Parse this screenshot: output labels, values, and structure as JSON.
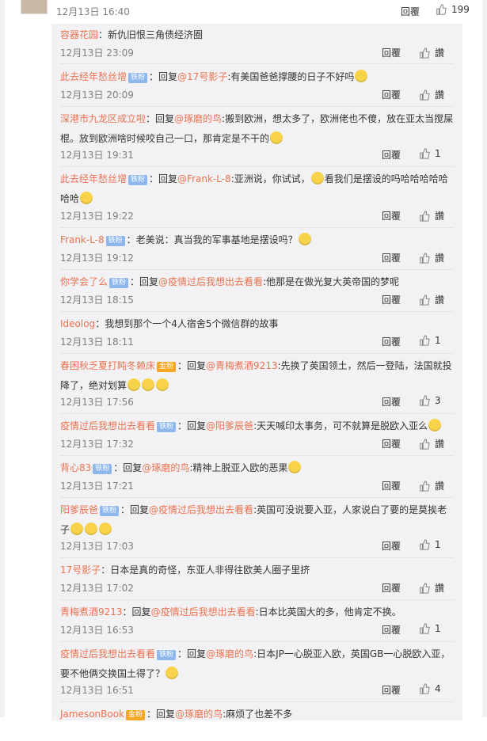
{
  "top": {
    "time": "12月13日 16:40",
    "reply": "回覆",
    "likes": "199"
  },
  "reply_label": "回覆",
  "replies": [
    {
      "user": "容器花园",
      "text": "：新仇旧恨三角债经济圈",
      "time": "12月13日 23:09",
      "likes": "讚"
    },
    {
      "user": "此去经年愁丝增",
      "badge": "铁粉",
      "text": "：回复",
      "mention": "@17号影子",
      "text2": ":有美国爸爸撑腰的日子不好吗",
      "time": "12月13日 20:09",
      "likes": "讚"
    },
    {
      "user": "深港市九龙区成立啦",
      "text": "：回复",
      "mention": "@琢磨的鸟",
      "text2": ":搬到欧洲，想太多了，欧洲佬也不傻，放在亚太当搅屎棍。放到欧洲啥时候咬自己一口，那肯定是不干的",
      "time": "12月13日 19:31",
      "likes": "1"
    },
    {
      "user": "此去经年愁丝增",
      "badge": "铁粉",
      "text": "：回复",
      "mention": "@Frank-L-8",
      "text2": ":亚洲说，你试试，",
      "text3": "看我们是摆设的吗哈哈哈哈哈哈哈",
      "time": "12月13日 19:22",
      "likes": "讚"
    },
    {
      "user": "Frank-L-8",
      "badge": "铁粉",
      "text": "：老美说：真当我的军事基地是摆设吗？",
      "time": "12月13日 19:12",
      "likes": "讚"
    },
    {
      "user": "你学会了么",
      "badge": "铁粉",
      "text": "：回复",
      "mention": "@疫情过后我想出去看看",
      "text2": ":他那是在做光复大英帝国的梦呢",
      "time": "12月13日 18:15",
      "likes": "讚"
    },
    {
      "user": "Ideolog",
      "text": "：我想到那个一个4人宿舍5个微信群的故事",
      "time": "12月13日 18:11",
      "likes": "1"
    },
    {
      "user": "春困秋乏夏打盹冬赖床",
      "badge": "金粉",
      "text": "：回复",
      "mention": "@青梅煮酒9213",
      "text2": ":先换了英国领土，然后一登陆，法国就投降了，绝对划算",
      "time": "12月13日 17:56",
      "likes": "3"
    },
    {
      "user": "疫情过后我想出去看看",
      "badge": "铁粉",
      "text": "：回复",
      "mention": "@阳爹辰爸",
      "text2": ":天天喊印太事务，可不就算是脱欧入亚么",
      "time": "12月13日 17:32",
      "likes": "讚"
    },
    {
      "user": "背心83",
      "badge": "铁粉",
      "text": "：回复",
      "mention": "@琢磨的鸟",
      "text2": ":精神上脱亚入欧的恶果",
      "time": "12月13日 17:21",
      "likes": "讚"
    },
    {
      "user": "阳爹辰爸",
      "badge": "铁粉",
      "text": "：回复",
      "mention": "@疫情过后我想出去看看",
      "text2": ":英国可没说要入亚，人家说白了要的是莫挨老子",
      "time": "12月13日 17:03",
      "likes": "1"
    },
    {
      "user": "17号影子",
      "text": "：日本是真的奇怪，东亚人非得往欧美人圈子里挤",
      "time": "12月13日 17:02",
      "likes": "讚"
    },
    {
      "user": "青梅煮酒9213",
      "text": "：回复",
      "mention": "@疫情过后我想出去看看",
      "text2": ":日本比英国大的多，他肯定不换。",
      "time": "12月13日 16:53",
      "likes": "1"
    },
    {
      "user": "疫情过后我想出去看看",
      "badge": "铁粉",
      "text": "：回复",
      "mention": "@琢磨的鸟",
      "text2": ":日本JP一心脱亚入欧，英国GB一心脱欧入亚，要不他俩交换国土得了？",
      "time": "12月13日 16:51",
      "likes": "4"
    },
    {
      "user": "JamesonBook",
      "badge": "金粉",
      "text": "：回复",
      "mention": "@琢磨的鸟",
      "text2": ":麻烦了也差不多",
      "time": "",
      "likes": ""
    }
  ]
}
